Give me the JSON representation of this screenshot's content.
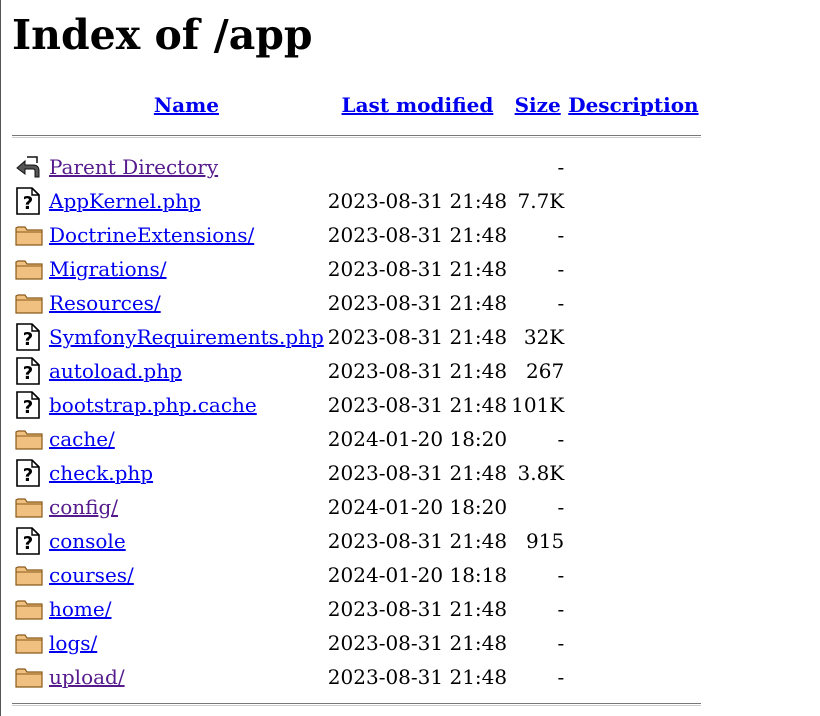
{
  "page": {
    "title": "Index of /app"
  },
  "table": {
    "headers": {
      "name": "Name",
      "last_modified": "Last modified",
      "size": "Size",
      "description": "Description"
    },
    "rows": [
      {
        "icon": "back-icon",
        "name": "Parent Directory",
        "modified": "",
        "size": "-",
        "visited": true
      },
      {
        "icon": "file-icon",
        "name": "AppKernel.php",
        "modified": "2023-08-31 21:48",
        "size": "7.7K",
        "visited": false
      },
      {
        "icon": "folder-icon",
        "name": "DoctrineExtensions/",
        "modified": "2023-08-31 21:48",
        "size": "-",
        "visited": false
      },
      {
        "icon": "folder-icon",
        "name": "Migrations/",
        "modified": "2023-08-31 21:48",
        "size": "-",
        "visited": false
      },
      {
        "icon": "folder-icon",
        "name": "Resources/",
        "modified": "2023-08-31 21:48",
        "size": "-",
        "visited": false
      },
      {
        "icon": "file-icon",
        "name": "SymfonyRequirements.php",
        "modified": "2023-08-31 21:48",
        "size": "32K",
        "visited": false
      },
      {
        "icon": "file-icon",
        "name": "autoload.php",
        "modified": "2023-08-31 21:48",
        "size": "267",
        "visited": false
      },
      {
        "icon": "file-icon",
        "name": "bootstrap.php.cache",
        "modified": "2023-08-31 21:48",
        "size": "101K",
        "visited": false
      },
      {
        "icon": "folder-icon",
        "name": "cache/",
        "modified": "2024-01-20 18:20",
        "size": "-",
        "visited": false
      },
      {
        "icon": "file-icon",
        "name": "check.php",
        "modified": "2023-08-31 21:48",
        "size": "3.8K",
        "visited": false
      },
      {
        "icon": "folder-icon",
        "name": "config/",
        "modified": "2024-01-20 18:20",
        "size": "-",
        "visited": true
      },
      {
        "icon": "file-icon",
        "name": "console",
        "modified": "2023-08-31 21:48",
        "size": "915",
        "visited": false
      },
      {
        "icon": "folder-icon",
        "name": "courses/",
        "modified": "2024-01-20 18:18",
        "size": "-",
        "visited": false
      },
      {
        "icon": "folder-icon",
        "name": "home/",
        "modified": "2023-08-31 21:48",
        "size": "-",
        "visited": false
      },
      {
        "icon": "folder-icon",
        "name": "logs/",
        "modified": "2023-08-31 21:48",
        "size": "-",
        "visited": false
      },
      {
        "icon": "folder-icon",
        "name": "upload/",
        "modified": "2023-08-31 21:48",
        "size": "-",
        "visited": true
      }
    ]
  },
  "colors": {
    "link": "#0000ee",
    "visited_link": "#551a8b",
    "folder_fill": "#f0c080",
    "folder_stroke": "#8a5a1a"
  }
}
